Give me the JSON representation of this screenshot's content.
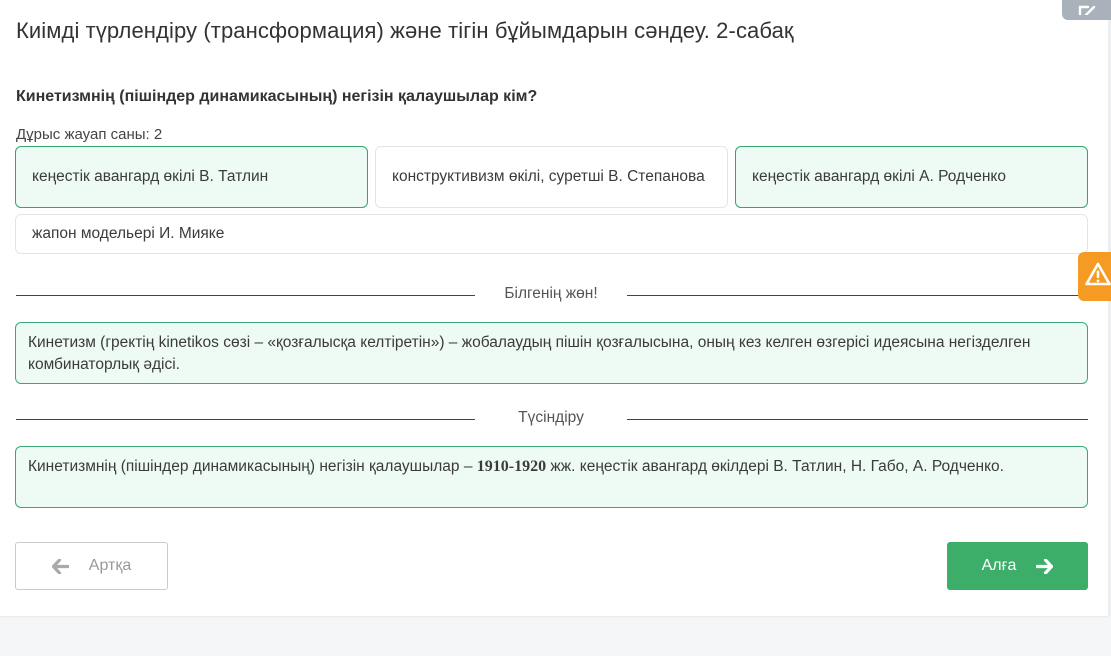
{
  "page": {
    "title": "Киімді түрлендіру (трансформация) және тігін бұйымдарын сәндеу. 2-сабақ"
  },
  "question": {
    "text": "Кинетизмнің (пішіндер динамикасының) негізін қалаушылар кім?",
    "correct_count_label": "Дұрыс жауап саны: 2"
  },
  "answers": [
    {
      "label": "кеңестік авангард өкілі В. Татлин",
      "selected": true
    },
    {
      "label": "конструктивизм өкілі, суретші В. Степанова",
      "selected": false
    },
    {
      "label": "кеңестік авангард өкілі А. Родченко",
      "selected": true
    },
    {
      "label": "жапон модельері И. Мияке",
      "selected": false
    }
  ],
  "did_you_know": {
    "heading": "Білгенің жөн!",
    "text": "Кинетизм (гректің kinetikos сөзі – «қозғалысқа келтіретін») – жобалаудың пішін қозғалысына, оның кез келген өзгерісі идеясына негізделген комбинаторлық әдісі."
  },
  "explanation": {
    "heading": "Түсіндіру",
    "text_before": "Кинетизмнің (пішіндер динамикасының) негізін қалаушылар – ",
    "years": "1910-1920",
    "text_after": " жж. кеңестік авангард өкілдері В. Татлин, Н. Габо, А. Родченко."
  },
  "navigation": {
    "back_label": "Артқа",
    "next_label": "Алға"
  },
  "icons": {
    "back": "arrow-left-icon",
    "next": "arrow-right-icon",
    "warning": "warning-triangle-icon",
    "expand": "expand-icon"
  },
  "colors": {
    "accent_green": "#3dae6a",
    "selected_border": "#34a56f",
    "selected_bg": "#eefaf4",
    "warning": "#f59a23"
  }
}
